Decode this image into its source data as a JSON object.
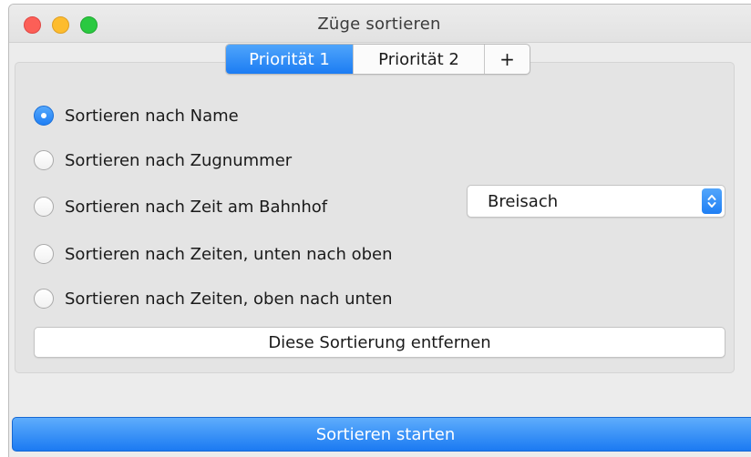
{
  "window": {
    "title": "Züge sortieren"
  },
  "tabs": [
    {
      "label": "Priorität 1",
      "selected": true
    },
    {
      "label": "Priorität 2",
      "selected": false
    },
    {
      "label": "+",
      "selected": false
    }
  ],
  "options": [
    {
      "label": "Sortieren nach Name",
      "checked": true
    },
    {
      "label": "Sortieren nach Zugnummer",
      "checked": false
    },
    {
      "label": "Sortieren nach Zeit am Bahnhof",
      "checked": false
    },
    {
      "label": "Sortieren nach Zeiten, unten nach oben",
      "checked": false
    },
    {
      "label": "Sortieren nach Zeiten, oben nach unten",
      "checked": false
    }
  ],
  "station_select": {
    "value": "Breisach"
  },
  "buttons": {
    "remove_sort": "Diese Sortierung entfernen",
    "start_sort": "Sortieren starten"
  },
  "colors": {
    "accent": "#1f7ff4",
    "close": "#fc5f57",
    "minimize": "#fdbc2e",
    "maximize": "#2ac940"
  },
  "icons": {
    "select_arrows": "chevron-up-down-icon"
  }
}
